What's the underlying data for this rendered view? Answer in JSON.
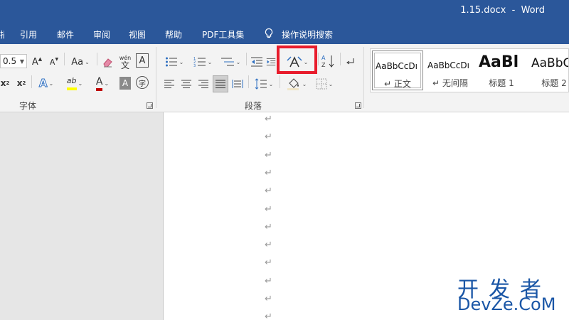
{
  "window": {
    "title": "1.15.docx  -  Word"
  },
  "tabs": [
    "引用",
    "邮件",
    "审阅",
    "视图",
    "帮助",
    "PDF工具集"
  ],
  "tell_me": {
    "label": "操作说明搜索",
    "icon": "lightbulb-icon"
  },
  "font_group": {
    "font_size": "0.5",
    "grow_font": "A",
    "shrink_font": "A",
    "change_case": "Aa",
    "phonetic_top": "wén",
    "phonetic_bottom": "文",
    "char_border": "A",
    "subscript": "x",
    "subscript_mark": "2",
    "superscript": "x",
    "superscript_mark": "2",
    "text_effects": "A",
    "highlight": "ab",
    "font_color": "A",
    "char_shading": "A",
    "enclose_char": "字",
    "label": "字体",
    "colors": {
      "highlight": "#ffff00",
      "font_color": "#c00000"
    }
  },
  "paragraph_group": {
    "label": "段落",
    "sort_label": "A Z",
    "selected_align": "justify",
    "highlight_button": "chinese-layout-button",
    "highlight_color": "#e81c2c"
  },
  "styles": [
    {
      "sample": "AaBbCcDı",
      "name": "正文",
      "selected": true
    },
    {
      "sample": "AaBbCcDı",
      "name": "无间隔",
      "selected": false
    },
    {
      "sample": "AaBl",
      "name": "标题 1",
      "selected": false
    },
    {
      "sample": "AaBbC",
      "name": "标题 2",
      "selected": false
    }
  ],
  "document": {
    "paragraph_mark": "↵",
    "paragraph_count": 12
  },
  "watermark": {
    "line1": "开发者",
    "line2": "DevZe.CoM"
  },
  "colors": {
    "title_bar": "#2b579a",
    "ribbon_bg": "#f3f3f3",
    "page_bg": "#ffffff",
    "canvas_bg": "#e6e6e6",
    "watermark": "#1a56a6"
  }
}
